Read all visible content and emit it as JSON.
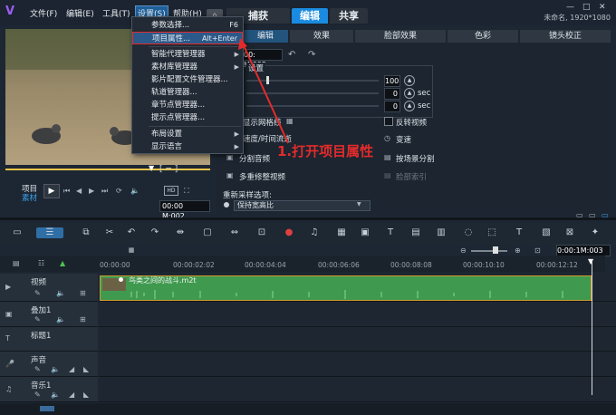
{
  "menubar": {
    "items": [
      "文件(F)",
      "编辑(E)",
      "工具(T)",
      "设置(S)",
      "帮助(H)"
    ],
    "active_index": 3
  },
  "main_tabs": [
    "捕获",
    "编辑",
    "共享"
  ],
  "active_main_tab": "编辑",
  "project_info": "未命名, 1920*1080",
  "window_controls": [
    "—",
    "□",
    "✕"
  ],
  "settings_menu": {
    "items": [
      {
        "label": "参数选择...",
        "shortcut": "F6"
      },
      {
        "label": "项目属性...",
        "shortcut": "Alt+Enter",
        "highlighted": true
      },
      {
        "label": "智能代理管理器",
        "submenu": true
      },
      {
        "label": "素材库管理器",
        "submenu": true
      },
      {
        "label": "影片配置文件管理器..."
      },
      {
        "label": "轨道管理器..."
      },
      {
        "label": "章节点管理器..."
      },
      {
        "label": "提示点管理器..."
      },
      {
        "label": "布局设置",
        "submenu": true
      },
      {
        "label": "显示语言",
        "submenu": true
      }
    ]
  },
  "annotation": "1.打开项目属性",
  "preview": {
    "mode_project": "项目",
    "mode_clip": "素材",
    "timecode": "00:00 M:002",
    "zoom": "HD"
  },
  "edit_panel": {
    "tabs": [
      "编辑",
      "效果",
      "脸部效果",
      "色彩",
      "镜头校正"
    ],
    "active_tab": "编辑",
    "timecode": "00: M:003",
    "settings_label": "设置",
    "rows": [
      {
        "value": "100",
        "unit": ""
      },
      {
        "value": "0",
        "unit": "sec"
      },
      {
        "value": "0",
        "unit": "sec"
      }
    ],
    "options_left": [
      "显示网格线",
      "速度/时间流逝",
      "分割音频",
      "多重修整视频"
    ],
    "options_right": [
      "反转视频",
      "变速",
      "按场景分割",
      "脸部索引"
    ],
    "resample_label": "重新采样选项:",
    "resample_value": "保持宽高比"
  },
  "timeline": {
    "timecode": "0:00:1M:003",
    "ruler_ticks": [
      "00:00:00",
      "00:00:02:02",
      "00:00:04:04",
      "00:00:06:06",
      "00:00:08:08",
      "00:00:10:10",
      "00:00:12:12"
    ],
    "tracks": [
      {
        "name": "视频",
        "icon": "video-icon"
      },
      {
        "name": "叠加1",
        "icon": "overlay-icon"
      },
      {
        "name": "标题1",
        "icon": "title-icon"
      },
      {
        "name": "声音",
        "icon": "voice-icon"
      },
      {
        "name": "音乐1",
        "icon": "music-icon"
      }
    ],
    "clip_title": "鸟类之间的战斗.m2t"
  },
  "colors": {
    "accent": "#1a8be0",
    "annotation_red": "#e32b2b",
    "clip_green": "#3f9a4f",
    "clip_border": "#d09a30"
  }
}
